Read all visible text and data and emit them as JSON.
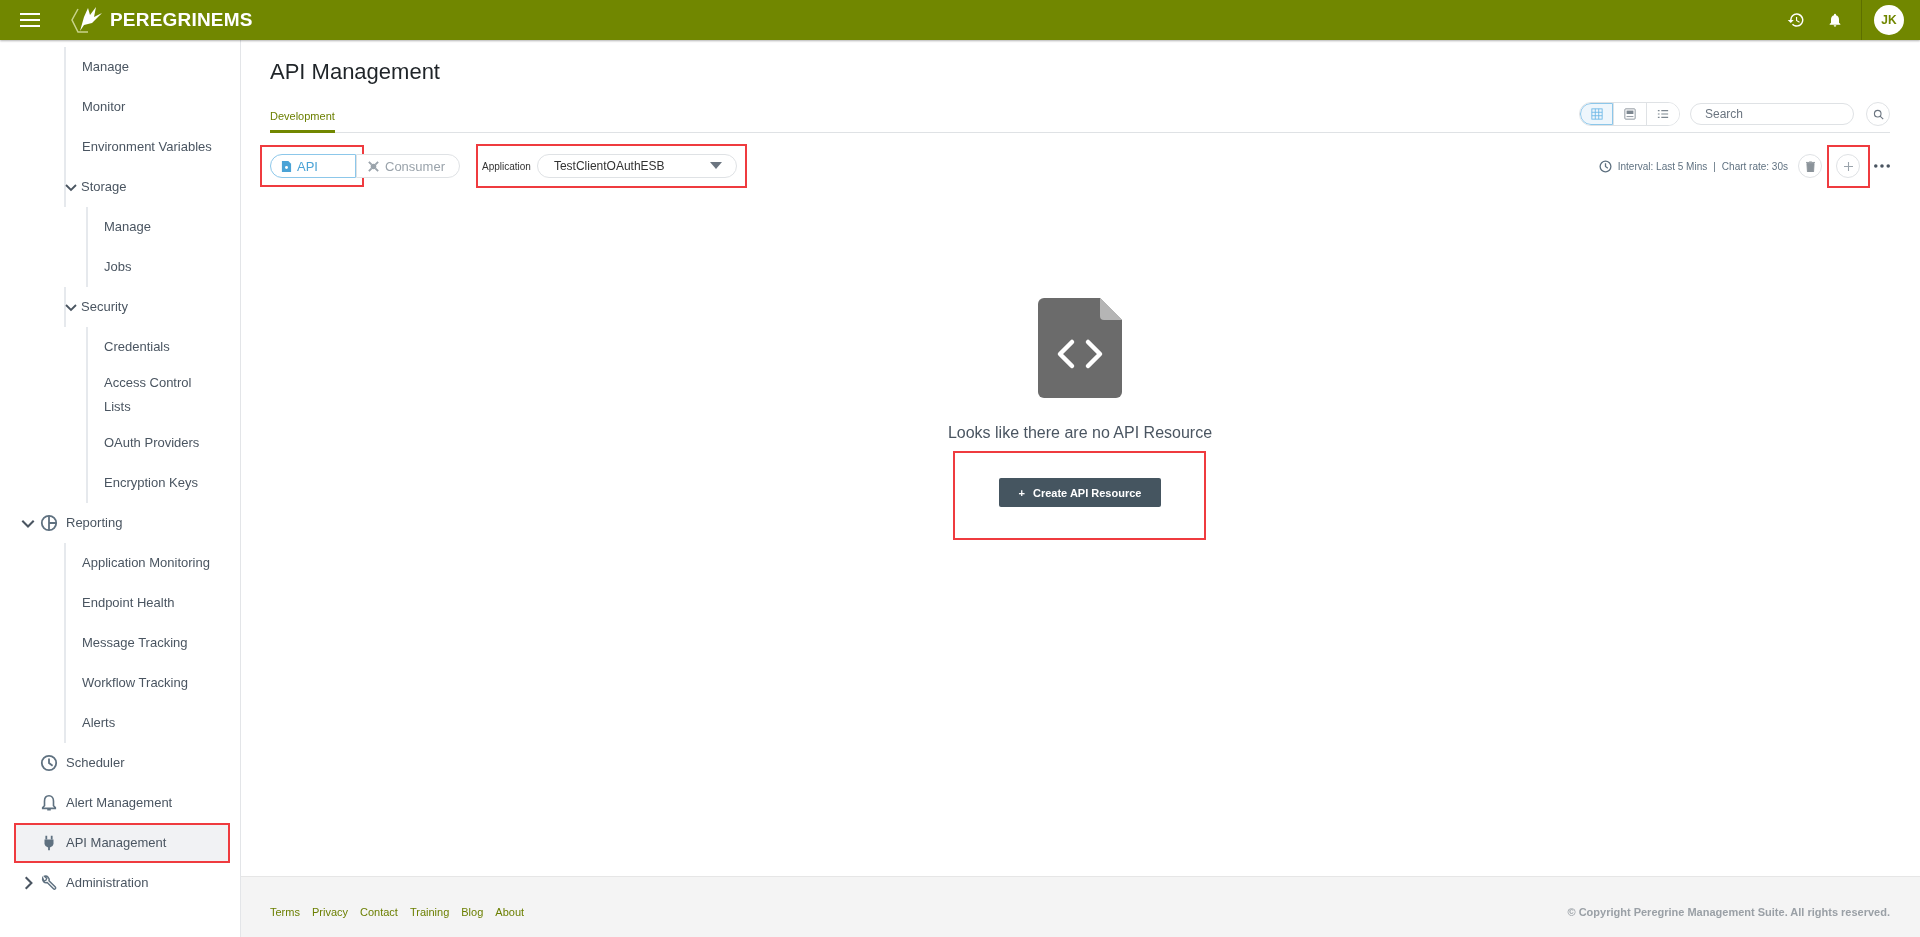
{
  "header": {
    "brand": "PEREGRINEMS",
    "avatar": "JK"
  },
  "sidebar": {
    "items": [
      {
        "kind": "group",
        "children": [
          {
            "label": "Manage",
            "selected": false,
            "highlighted": false
          },
          {
            "label": "Monitor",
            "selected": false,
            "highlighted": false
          },
          {
            "label": "Environment Variables",
            "selected": false,
            "highlighted": false
          },
          {
            "label": "Storage",
            "selected": false,
            "highlighted": false,
            "expanded": true,
            "children": [
              {
                "label": "Manage",
                "selected": false,
                "highlighted": false
              },
              {
                "label": "Jobs",
                "selected": false,
                "highlighted": false
              }
            ]
          },
          {
            "label": "Security",
            "selected": false,
            "highlighted": false,
            "expanded": true,
            "children": [
              {
                "label": "Credentials",
                "selected": false,
                "highlighted": false
              },
              {
                "label": "Access Control Lists",
                "selected": false,
                "highlighted": false
              },
              {
                "label": "OAuth Providers",
                "selected": false,
                "highlighted": false
              },
              {
                "label": "Encryption Keys",
                "selected": false,
                "highlighted": false
              }
            ]
          }
        ]
      },
      {
        "label": "Reporting",
        "selected": false,
        "highlighted": false,
        "expanded": true,
        "children": [
          {
            "label": "Application Monitoring",
            "selected": false,
            "highlighted": false
          },
          {
            "label": "Endpoint Health",
            "selected": false,
            "highlighted": false
          },
          {
            "label": "Message Tracking",
            "selected": false,
            "highlighted": false
          },
          {
            "label": "Workflow Tracking",
            "selected": false,
            "highlighted": false
          },
          {
            "label": "Alerts",
            "selected": false,
            "highlighted": false
          }
        ]
      },
      {
        "label": "Scheduler",
        "selected": false,
        "highlighted": false
      },
      {
        "label": "Alert Management",
        "selected": false,
        "highlighted": false
      },
      {
        "label": "API Management",
        "selected": true,
        "highlighted": true
      },
      {
        "label": "Administration",
        "selected": false,
        "highlighted": false,
        "expanded": false
      }
    ]
  },
  "page": {
    "title": "API Management",
    "tabs": [
      {
        "label": "Development",
        "selected": true
      }
    ],
    "view_modes": [
      {
        "kind": "grid",
        "selected": true
      },
      {
        "kind": "cards",
        "selected": false
      },
      {
        "kind": "list",
        "selected": false
      }
    ],
    "search": {
      "placeholder": "Search"
    },
    "type_toggle": [
      {
        "label": "API",
        "selected": true,
        "highlighted": true
      },
      {
        "label": "Consumer",
        "selected": false,
        "highlighted": false
      }
    ],
    "application": {
      "label": "Application",
      "value": "TestClientOAuthESB",
      "highlighted": true
    },
    "interval": "Interval: Last 5 Mins",
    "separator": "|",
    "chart_rate": "Chart rate: 30s",
    "add_highlighted": true,
    "empty": {
      "message": "Looks like there are no API Resource",
      "button": "Create API Resource",
      "button_icon": "+",
      "highlighted": true
    }
  },
  "footer": {
    "links": [
      "Terms",
      "Privacy",
      "Contact",
      "Training",
      "Blog",
      "About"
    ],
    "copyright": "© Copyright Peregrine Management Suite. All rights reserved."
  }
}
